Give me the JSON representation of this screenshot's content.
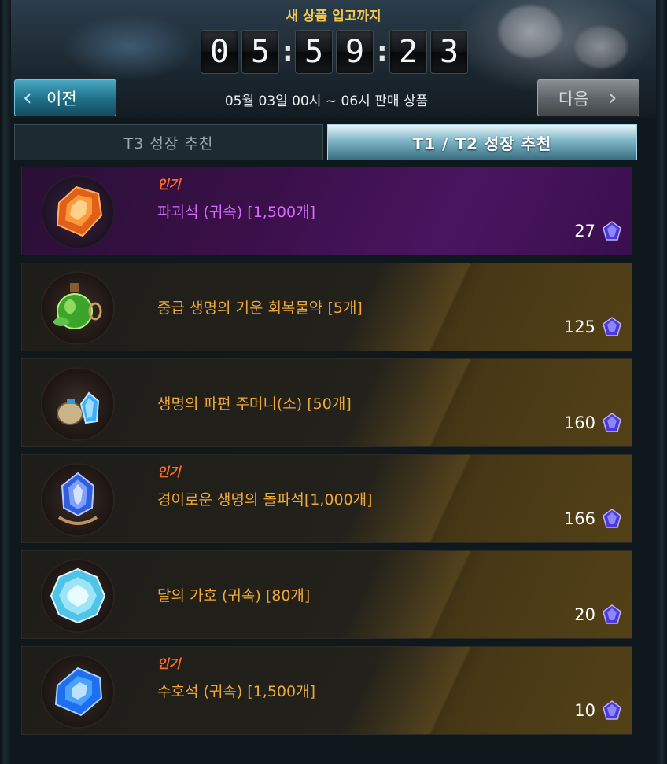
{
  "header": {
    "timer_title": "새 상품 입고까지",
    "timer_digits": [
      "0",
      "5",
      ":",
      "5",
      "9",
      ":",
      "2",
      "3"
    ],
    "prev_label": "이전",
    "next_label": "다음",
    "sale_label": "05월 03일 00시 ~ 06시 판매 상품"
  },
  "tabs": [
    {
      "label": "T3 성장 추천",
      "active": false
    },
    {
      "label": "T1 / T2 성장 추천",
      "active": true
    }
  ],
  "items": [
    {
      "badge": "인기",
      "name": "파괴석 (귀속) [1,500개]",
      "price": "27",
      "style": "purple",
      "icon": "orange-crystal-icon"
    },
    {
      "badge": "",
      "name": "중급 생명의 기운 회복물약 [5개]",
      "price": "125",
      "style": "gold",
      "icon": "green-potion-icon"
    },
    {
      "badge": "",
      "name": "생명의 파편 주머니(소) [50개]",
      "price": "160",
      "style": "gold",
      "icon": "pouch-crystal-icon"
    },
    {
      "badge": "인기",
      "name": "경이로운 생명의 돌파석[1,000개]",
      "price": "166",
      "style": "gold",
      "icon": "blue-breakthrough-stone-icon"
    },
    {
      "badge": "",
      "name": "달의 가호 (귀속) [80개]",
      "price": "20",
      "style": "gold",
      "icon": "moon-gem-icon"
    },
    {
      "badge": "인기",
      "name": "수호석 (귀속) [1,500개]",
      "price": "10",
      "style": "gold",
      "icon": "blue-crystal-icon"
    }
  ],
  "colors": {
    "badge": "#ff6a2a",
    "name_gold": "#f0a83a",
    "name_purple": "#d86bff",
    "timer_title": "#f2c94c"
  }
}
